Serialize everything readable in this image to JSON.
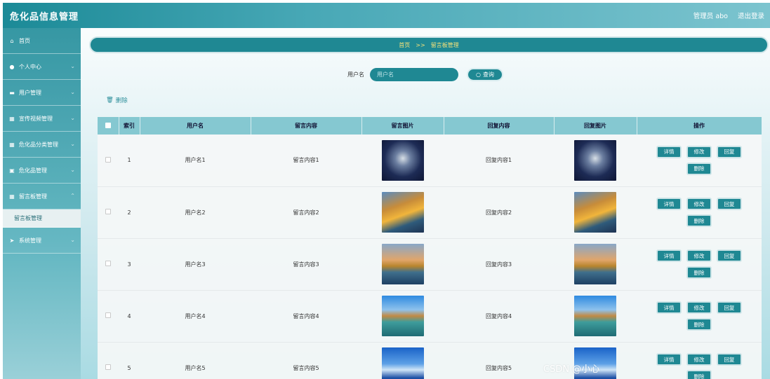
{
  "app": {
    "title": "危化品信息管理",
    "user_label": "管理员 abo",
    "logout_label": "退出登录"
  },
  "sidebar": {
    "items": [
      {
        "label": "首页",
        "icon": "home-icon",
        "glyph": "⌂"
      },
      {
        "label": "个人中心",
        "icon": "user-icon",
        "glyph": "●"
      },
      {
        "label": "用户管理",
        "icon": "monitor-icon",
        "glyph": "▬"
      },
      {
        "label": "宣传视频管理",
        "icon": "grid-icon",
        "glyph": "▦"
      },
      {
        "label": "危化品分类管理",
        "icon": "grid-icon",
        "glyph": "▦"
      },
      {
        "label": "危化品管理",
        "icon": "lock-icon",
        "glyph": "▣"
      },
      {
        "label": "留言板管理",
        "icon": "grid-icon",
        "glyph": "▦"
      },
      {
        "label": "系统管理",
        "icon": "send-icon",
        "glyph": "➤"
      }
    ],
    "submenu_label": "留言板管理"
  },
  "breadcrumb": {
    "home": "首页",
    "separator": ">>",
    "current": "留言板管理"
  },
  "search": {
    "label": "用户名",
    "placeholder": "用户名",
    "button_label": "查询"
  },
  "toolbar": {
    "delete_label": "删除"
  },
  "table": {
    "headers": [
      "索引",
      "用户名",
      "留言内容",
      "留言图片",
      "回复内容",
      "回复图片",
      "操作"
    ],
    "rows": [
      {
        "index": "1",
        "username": "用户名1",
        "content": "留言内容1",
        "reply": "回复内容1"
      },
      {
        "index": "2",
        "username": "用户名2",
        "content": "留言内容2",
        "reply": "回复内容2"
      },
      {
        "index": "3",
        "username": "用户名3",
        "content": "留言内容3",
        "reply": "回复内容3"
      },
      {
        "index": "4",
        "username": "用户名4",
        "content": "留言内容4",
        "reply": "回复内容4"
      },
      {
        "index": "5",
        "username": "用户名5",
        "content": "留言内容5",
        "reply": "回复内容5"
      }
    ],
    "actions": {
      "detail": "详情",
      "edit": "修改",
      "reply": "回复",
      "delete": "删除"
    }
  },
  "watermark": "CSDN @小心"
}
